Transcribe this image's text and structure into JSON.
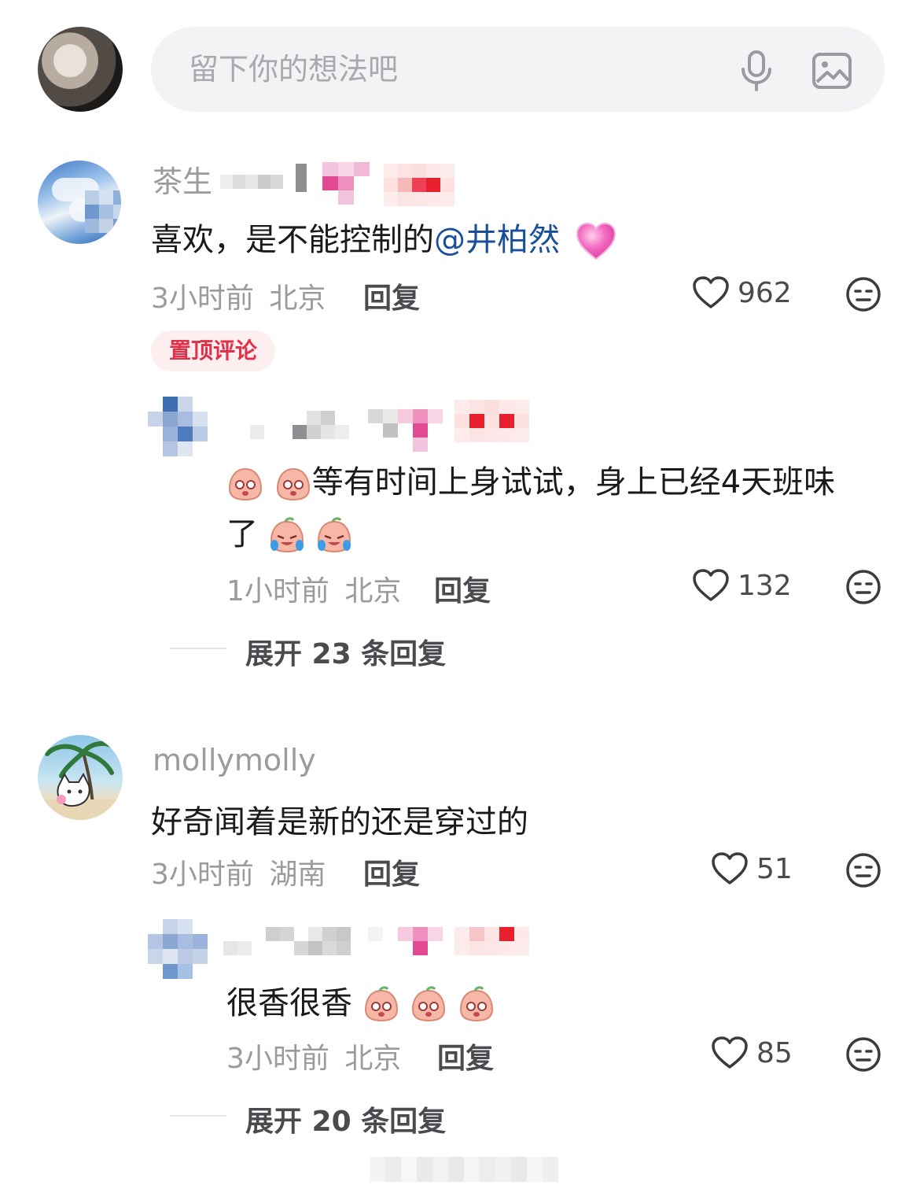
{
  "input_bar": {
    "placeholder": "留下你的想法吧",
    "mic_icon": "microphone-icon",
    "image_icon": "image-icon"
  },
  "comments": [
    {
      "username": "茶生",
      "text_before": "喜欢，是不能控制的",
      "mention": "@井柏然",
      "emoji": "pink-heart-emoji",
      "time": "3小时前",
      "location": "北京",
      "reply_label": "回复",
      "likes": "962",
      "pinned_label": "置顶评论",
      "reply": {
        "text_line1": "等有时间上身试试，身上已经4天班味",
        "text_line2": "了",
        "time": "1小时前",
        "location": "北京",
        "reply_label": "回复",
        "likes": "132"
      },
      "expand_label": "展开 23 条回复"
    },
    {
      "username": "mollymolly",
      "text": "好奇闻着是新的还是穿过的",
      "time": "3小时前",
      "location": "湖南",
      "reply_label": "回复",
      "likes": "51",
      "reply": {
        "text": "很香很香",
        "time": "3小时前",
        "location": "北京",
        "reply_label": "回复",
        "likes": "85"
      },
      "expand_label": "展开 20 条回复"
    }
  ],
  "colors": {
    "mention": "#1b4f9c",
    "pinned_text": "#e0304a",
    "pinned_bg": "#fdeff0",
    "meta": "#9a9a9f"
  }
}
